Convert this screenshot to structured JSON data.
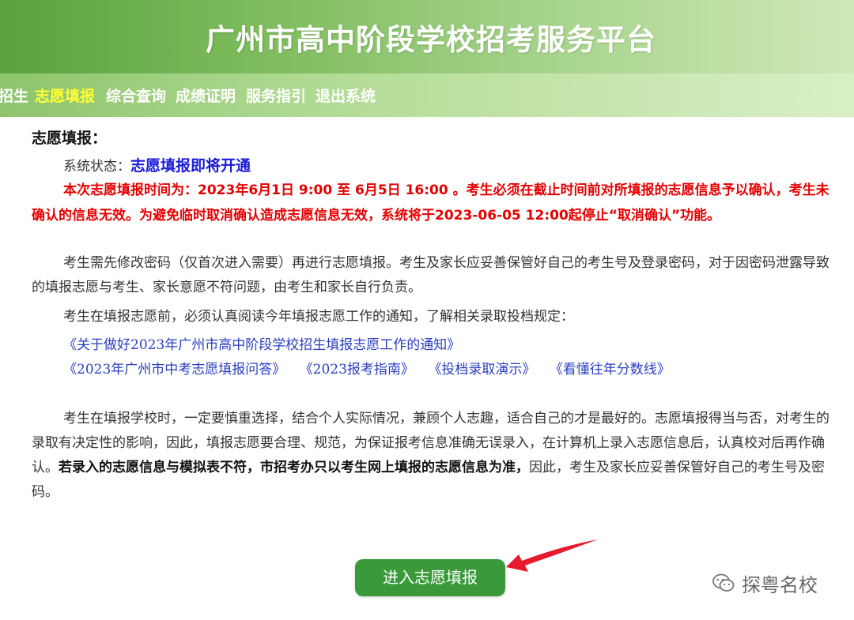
{
  "site_title": "广州市高中阶段学校招考服务平台",
  "nav": [
    {
      "label": "招生",
      "active": false
    },
    {
      "label": "志愿填报",
      "active": true
    },
    {
      "label": "综合查询",
      "active": false
    },
    {
      "label": "成绩证明",
      "active": false
    },
    {
      "label": "服务指引",
      "active": false
    },
    {
      "label": "退出系统",
      "active": false
    }
  ],
  "section_title": "志愿填报：",
  "status": {
    "label": "系统状态：",
    "value": "志愿填报即将开通"
  },
  "notice": "本次志愿填报时间为：2023年6月1日 9:00 至 6月5日 16:00 。考生必须在截止时间前对所填报的志愿信息予以确认，考生未确认的信息无效。为避免临时取消确认造成志愿信息无效，系统将于2023-06-05 12:00起停止“取消确认”功能。",
  "para1": "考生需先修改密码（仅首次进入需要）再进行志愿填报。考生及家长应妥善保管好自己的考生号及登录密码，对于因密码泄露导致的填报志愿与考生、家长意愿不符问题，由考生和家长自行负责。",
  "para2": "考生在填报志愿前，必须认真阅读今年填报志愿工作的通知，了解相关录取投档规定：",
  "links_row1": [
    "《关于做好2023年广州市高中阶段学校招生填报志愿工作的通知》"
  ],
  "links_row2": [
    "《2023年广州市中考志愿填报问答》",
    "《2023报考指南》",
    "《投档录取演示》",
    "《看懂往年分数线》"
  ],
  "para3_normal": "考生在填报学校时，一定要慎重选择，结合个人实际情况，兼顾个人志趣，适合自己的才是最好的。志愿填报得当与否，对考生的录取有决定性的影响，因此，填报志愿要合理、规范，为保证报考信息准确无误录入，在计算机上录入志愿信息后，认真校对后再作确认。",
  "para3_bold": "若录入的志愿信息与模拟表不符，市招考办只以考生网上填报的志愿信息为准，",
  "para3_tail": "因此，考生及家长应妥善保管好自己的考生号及密码。",
  "enter_button": "进入志愿填报",
  "watermark": "探粤名校",
  "colors": {
    "header_green": "#5aa33f",
    "nav_active": "#ffff33",
    "notice_red": "#e60000",
    "status_blue": "#1a1adb",
    "link_blue": "#2a3fbf",
    "button_green": "#3a9a3a",
    "arrow_red": "#e8192c"
  }
}
